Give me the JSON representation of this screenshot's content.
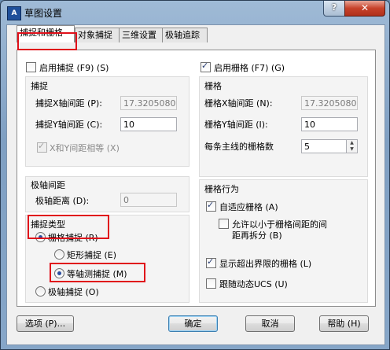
{
  "window": {
    "title": "草图设置",
    "app_icon": "AutoCAD-icon",
    "help_glyph": "?",
    "close_glyph": "✕"
  },
  "tabs": [
    {
      "label": "捕捉和栅格",
      "active": true
    },
    {
      "label": "对象捕捉",
      "active": false
    },
    {
      "label": "三维设置",
      "active": false
    },
    {
      "label": "极轴追踪",
      "active": false
    }
  ],
  "snap": {
    "enable_label": "启用捕捉 (F9) (S)",
    "enabled": false,
    "group_title": "捕捉",
    "x_spacing_label": "捕捉X轴间距 (P):",
    "x_spacing_value": "17.32050807",
    "y_spacing_label": "捕捉Y轴间距 (C):",
    "y_spacing_value": "10",
    "equal_xy_label": "X和Y间距相等 (X)",
    "equal_xy_checked": true
  },
  "polar": {
    "group_title": "极轴间距",
    "distance_label": "极轴距离 (D):",
    "distance_value": "0"
  },
  "snap_type": {
    "group_title": "捕捉类型",
    "grid_snap_label": "栅格捕捉 (R)",
    "rect_snap_label": "矩形捕捉 (E)",
    "iso_snap_label": "等轴测捕捉 (M)",
    "polar_snap_label": "极轴捕捉 (O)"
  },
  "grid": {
    "enable_label": "启用栅格 (F7) (G)",
    "enabled": true,
    "group_title": "栅格",
    "x_spacing_label": "栅格X轴间距 (N):",
    "x_spacing_value": "17.32050807",
    "y_spacing_label": "栅格Y轴间距 (I):",
    "y_spacing_value": "10",
    "major_label": "每条主线的栅格数",
    "major_value": "5"
  },
  "grid_behavior": {
    "group_title": "栅格行为",
    "adaptive_label": "自适应栅格 (A)",
    "subdivide_label_line1": "允许以小于栅格间距的间",
    "subdivide_label_line2": "距再拆分 (B)",
    "beyond_limits_label": "显示超出界限的栅格 (L)",
    "follow_ucs_label": "跟随动态UCS (U)"
  },
  "buttons": {
    "options": "选项 (P)...",
    "ok": "确定",
    "cancel": "取消",
    "help": "帮助 (H)"
  },
  "highlight_color": "#e0101a"
}
